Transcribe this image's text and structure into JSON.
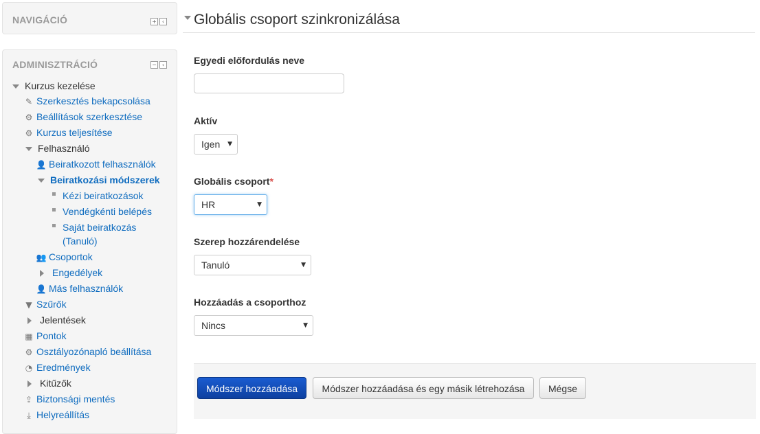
{
  "nav_block": {
    "title": "NAVIGÁCIÓ"
  },
  "admin_block": {
    "title": "ADMINISZTRÁCIÓ",
    "items": [
      {
        "label": "Kurzus kezelése",
        "icon": "caret-down-icon"
      },
      {
        "label": "Szerkesztés bekapcsolása",
        "icon": "pencil-icon"
      },
      {
        "label": "Beállítások szerkesztése",
        "icon": "gear-icon"
      },
      {
        "label": "Kurzus teljesítése",
        "icon": "gear-icon"
      },
      {
        "label": "Felhasználó",
        "icon": "caret-down-icon"
      },
      {
        "label": "Beiratkozott felhasználók",
        "icon": "user-icon"
      },
      {
        "label": "Beiratkozási módszerek",
        "icon": "caret-down-icon"
      },
      {
        "label": "Kézi beiratkozások",
        "icon": "bullet-icon"
      },
      {
        "label": "Vendégkénti belépés",
        "icon": "bullet-icon"
      },
      {
        "label": "Saját beiratkozás",
        "icon": "bullet-icon"
      },
      {
        "label": "(Tanuló)",
        "icon": ""
      },
      {
        "label": "Csoportok",
        "icon": "users-icon"
      },
      {
        "label": "Engedélyek",
        "icon": "caret-right-icon"
      },
      {
        "label": "Más felhasználók",
        "icon": "user-icon"
      },
      {
        "label": "Szűrők",
        "icon": "filter-icon"
      },
      {
        "label": "Jelentések",
        "icon": "caret-right-icon"
      },
      {
        "label": "Pontok",
        "icon": "table-icon"
      },
      {
        "label": "Osztályozónapló beállítása",
        "icon": "gear-icon"
      },
      {
        "label": "Eredmények",
        "icon": "award-icon"
      },
      {
        "label": "Kitűzők",
        "icon": "caret-right-icon"
      },
      {
        "label": "Biztonsági mentés",
        "icon": "upload-icon"
      },
      {
        "label": "Helyreállítás",
        "icon": "download-icon"
      }
    ]
  },
  "form": {
    "title": "Globális csoport szinkronizálása",
    "instance_label": "Egyedi előfordulás neve",
    "instance_value": "",
    "active_label": "Aktív",
    "active_value": "Igen",
    "cohort_label": "Globális csoport",
    "cohort_required": "*",
    "cohort_value": "HR",
    "role_label": "Szerep hozzárendelése",
    "role_value": "Tanuló",
    "group_label": "Hozzáadás a csoporthoz",
    "group_value": "Nincs",
    "caret": "▼"
  },
  "buttons": {
    "add": "Módszer hozzáadása",
    "add_another": "Módszer hozzáadása és egy másik létrehozása",
    "cancel": "Mégse"
  },
  "colors": {
    "link": "#0f6cbf",
    "primary_button": "#0f47ad",
    "required": "#d9534f"
  }
}
